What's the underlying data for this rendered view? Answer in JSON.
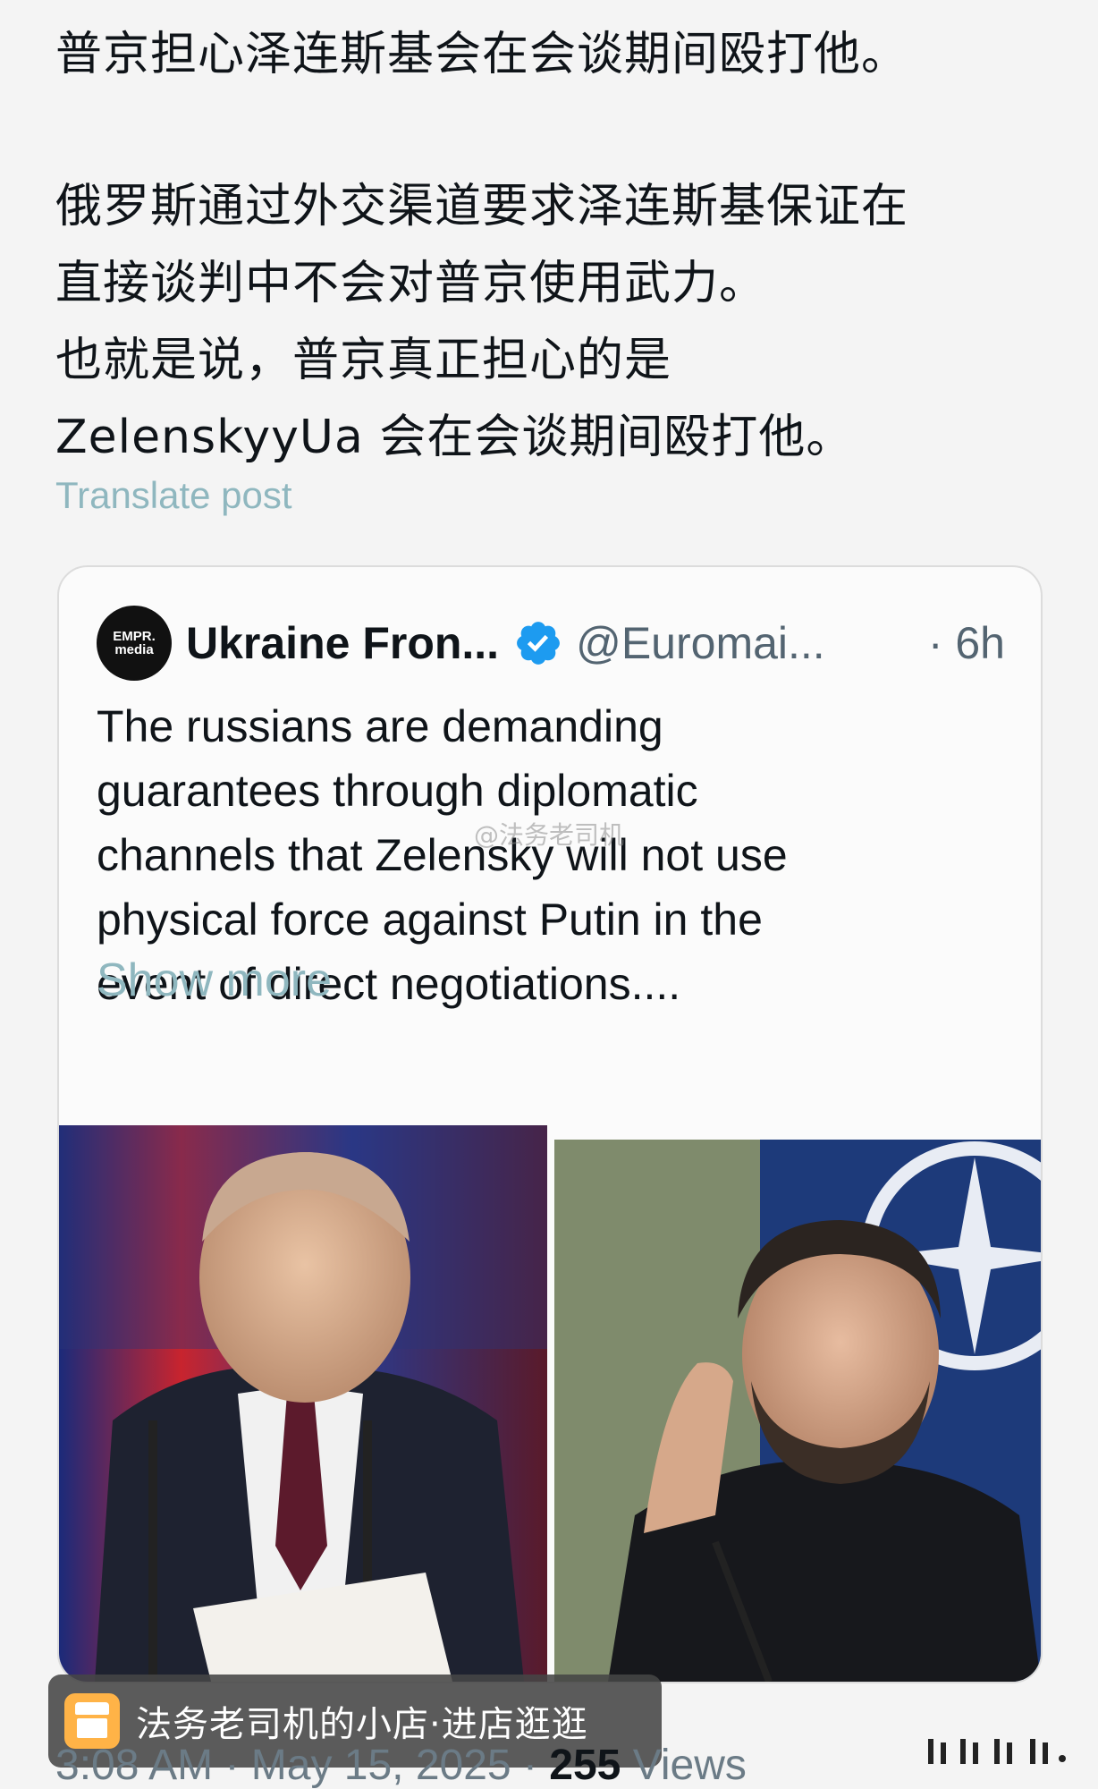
{
  "post": {
    "line1": "普京担心泽连斯基会在会谈期间殴打他。",
    "line2": "俄罗斯通过外交渠道要求泽连斯基保证在",
    "line3": "直接谈判中不会对普京使用武力。",
    "line4": "也就是说，普京真正担心的是",
    "line5": "ZelenskyyUa 会在会谈期间殴打他。",
    "translate_label": "Translate post"
  },
  "quote": {
    "avatar_line1": "EMPR.",
    "avatar_line2": "media",
    "display_name": "Ukraine Fron...",
    "handle": "@Euromai...",
    "time": "· 6h",
    "body": [
      "The russians are demanding",
      "guarantees through diplomatic",
      "channels that Zelensky will not use",
      "physical force against Putin in the",
      "event of direct negotiations...."
    ],
    "show_more": "Show more",
    "verified_color": "#1d9bf0"
  },
  "watermark": "@法务老司机",
  "store": {
    "label": "法务老司机的小店·进店逛逛",
    "icon": "store-icon"
  },
  "footer": {
    "time": "3:08 AM · May 15, 2025 · ",
    "views_count": "255",
    "views_label": " Views"
  },
  "colors": {
    "link": "#8fb7bf",
    "text": "#0f1419",
    "muted": "#536471"
  }
}
